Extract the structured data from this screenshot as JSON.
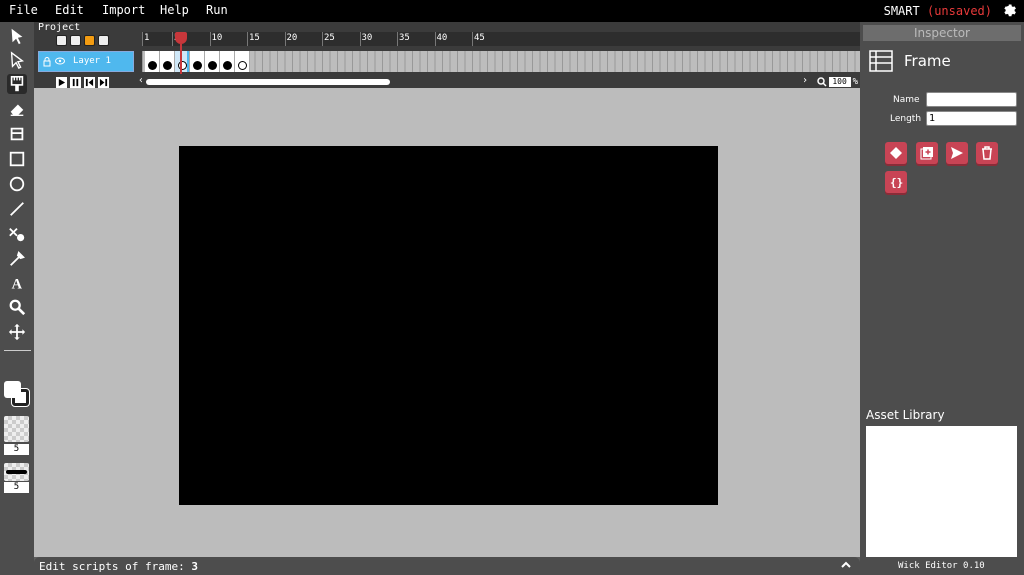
{
  "menu": {
    "file": "File",
    "edit": "Edit",
    "import": "Import",
    "help": "Help",
    "run": "Run"
  },
  "project": {
    "name": "SMART",
    "status": "(unsaved)"
  },
  "tools": [
    {
      "name": "cursor-icon"
    },
    {
      "name": "pointer-icon"
    },
    {
      "name": "brush-icon",
      "active": true
    },
    {
      "name": "eraser-icon"
    },
    {
      "name": "fill-bucket-icon"
    },
    {
      "name": "rectangle-icon"
    },
    {
      "name": "ellipse-icon"
    },
    {
      "name": "line-icon"
    },
    {
      "name": "path-edit-icon"
    },
    {
      "name": "eyedropper-icon"
    },
    {
      "name": "text-icon"
    },
    {
      "name": "zoom-icon"
    },
    {
      "name": "pan-icon"
    }
  ],
  "color_panel": {
    "fill_color": "#ffffff",
    "stroke_color": "#222222",
    "opacity_value": "5",
    "brush_size_value": "5"
  },
  "timeline": {
    "project_label": "Project",
    "ruler_labels": [
      "1",
      "5",
      "10",
      "15",
      "20",
      "25",
      "30",
      "35",
      "40",
      "45"
    ],
    "layer_name": "Layer 1",
    "current_frame": 3,
    "frames": [
      {
        "type": "filled"
      },
      {
        "type": "filled"
      },
      {
        "type": "hollow",
        "selected": true
      },
      {
        "type": "filled"
      },
      {
        "type": "filled"
      },
      {
        "type": "filled"
      },
      {
        "type": "hollow"
      }
    ],
    "zoom_value": "100",
    "zoom_unit": "%"
  },
  "statusbar": {
    "prefix": "Edit scripts of frame:",
    "frame": "3"
  },
  "inspector": {
    "tab_label": "Inspector",
    "title": "Frame",
    "name_label": "Name",
    "name_value": "",
    "length_label": "Length",
    "length_value": "1",
    "buttons": [
      "keyframe-icon",
      "duplicate-icon",
      "send-icon",
      "trash-icon",
      "script-braces-icon"
    ],
    "button_color": "#c84455"
  },
  "asset_library": {
    "title": "Asset Library"
  },
  "version": "Wick Editor 0.10",
  "colors": {
    "accent": "#4fb8ee",
    "playhead": "#c8373b",
    "canvas_bg": "#bcbcbc",
    "stage": "#000000"
  }
}
